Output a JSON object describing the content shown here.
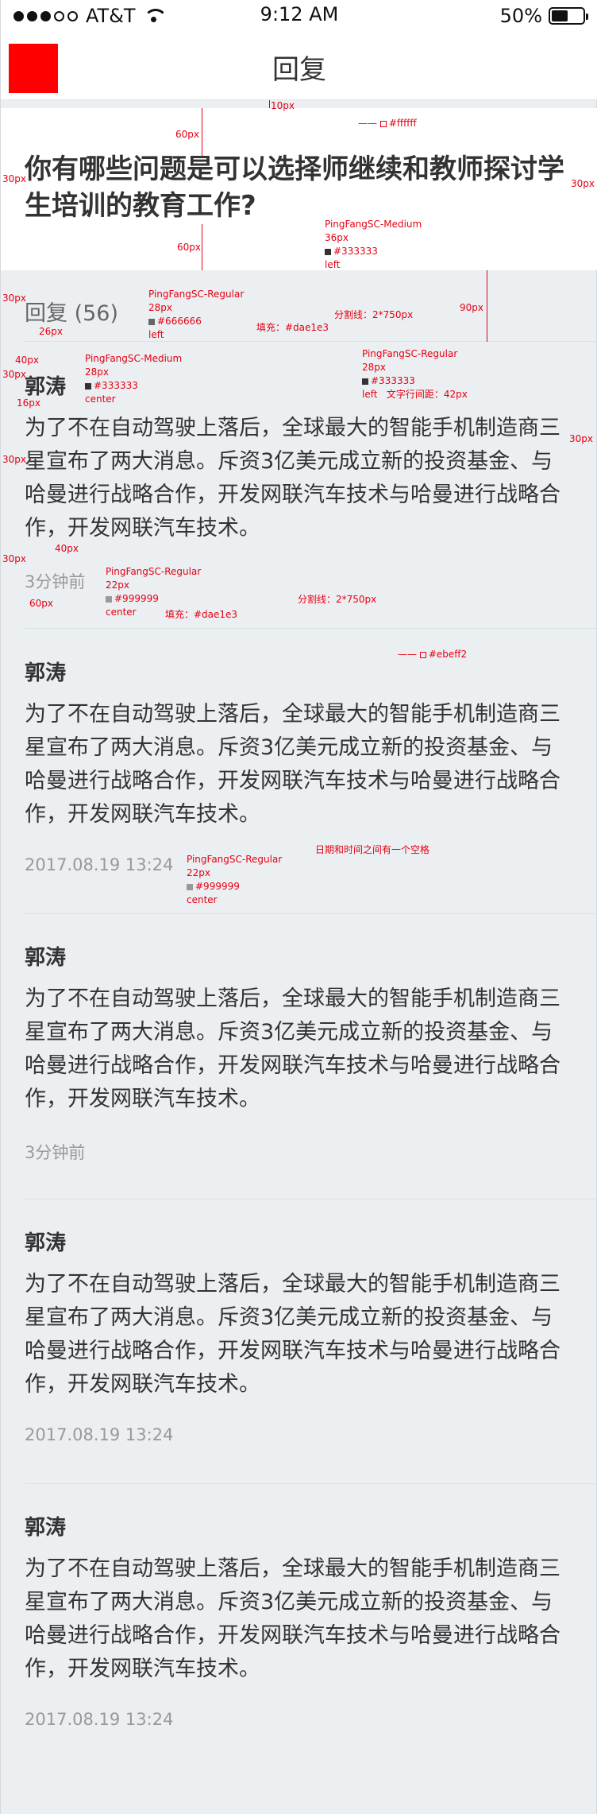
{
  "status_bar": {
    "carrier": "AT&T",
    "time": "9:12 AM",
    "battery": "50%"
  },
  "nav": {
    "title": "回复"
  },
  "question": {
    "text": "你有哪些问题是可以选择师继续和教师探讨学生培训的教育工作?"
  },
  "reply_header": {
    "label": "回复 (56)"
  },
  "replies": [
    {
      "name": "郭涛",
      "content": "为了不在自动驾驶上落后，全球最大的智能手机制造商三星宣布了两大消息。斥资3亿美元成立新的投资基金、与哈曼进行战略合作，开发网联汽车技术与哈曼进行战略合作，开发网联汽车技术。",
      "time": "3分钟前"
    },
    {
      "name": "郭涛",
      "content": "为了不在自动驾驶上落后，全球最大的智能手机制造商三星宣布了两大消息。斥资3亿美元成立新的投资基金、与哈曼进行战略合作，开发网联汽车技术与哈曼进行战略合作，开发网联汽车技术。",
      "time": "2017.08.19 13:24"
    },
    {
      "name": "郭涛",
      "content": "为了不在自动驾驶上落后，全球最大的智能手机制造商三星宣布了两大消息。斥资3亿美元成立新的投资基金、与哈曼进行战略合作，开发网联汽车技术与哈曼进行战略合作，开发网联汽车技术。",
      "time": "3分钟前"
    },
    {
      "name": "郭涛",
      "content": "为了不在自动驾驶上落后，全球最大的智能手机制造商三星宣布了两大消息。斥资3亿美元成立新的投资基金、与哈曼进行战略合作，开发网联汽车技术与哈曼进行战略合作，开发网联汽车技术。",
      "time": "2017.08.19 13:24"
    },
    {
      "name": "郭涛",
      "content": "为了不在自动驾驶上落后，全球最大的智能手机制造商三星宣布了两大消息。斥资3亿美元成立新的投资基金、与哈曼进行战略合作，开发网联汽车技术与哈曼进行战略合作，开发网联汽车技术。",
      "time": "2017.08.19 13:24"
    }
  ],
  "annotations": {
    "top_gap": "10px",
    "white_fill": "#ffffff",
    "pad_60_a": "60px",
    "side_30_a": "30px",
    "side_30_b": "30px",
    "q_font": "PingFangSC-Medium",
    "q_size": "36px",
    "q_color": "#333333",
    "q_align": "left",
    "pad_60_b": "60px",
    "rh_side": "30px",
    "rh_font": "PingFangSC-Regular",
    "rh_size": "28px",
    "rh_color": "#666666",
    "rh_align": "left",
    "rh_gap": "26px",
    "divider1": "分割线：2*750px",
    "fill1": "填充：#dae1e3",
    "h90": "90px",
    "name_gap": "40px",
    "name_font": "PingFangSC-Medium",
    "name_size": "28px",
    "name_color": "#333333",
    "name_align": "center",
    "side_30_c": "30px",
    "gap_16": "16px",
    "body_font": "PingFangSC-Regular",
    "body_size": "28px",
    "body_color": "#333333",
    "body_align": "left",
    "line_gap": "文字行间距：42px",
    "side_30_d": "30px",
    "side_30_e": "30px",
    "time_gap": "40px",
    "side_30_f": "30px",
    "time_font": "PingFangSC-Regular",
    "time_size": "22px",
    "time_color": "#999999",
    "time_align": "center",
    "pad_60_c": "60px",
    "divider2": "分割线：2*750px",
    "fill2": "填充：#dae1e3",
    "bg_fill": "#ebeff2",
    "date_note": "日期和时间之间有一个空格",
    "t2_font": "PingFangSC-Regular",
    "t2_size": "22px",
    "t2_color": "#999999",
    "t2_align": "center"
  }
}
